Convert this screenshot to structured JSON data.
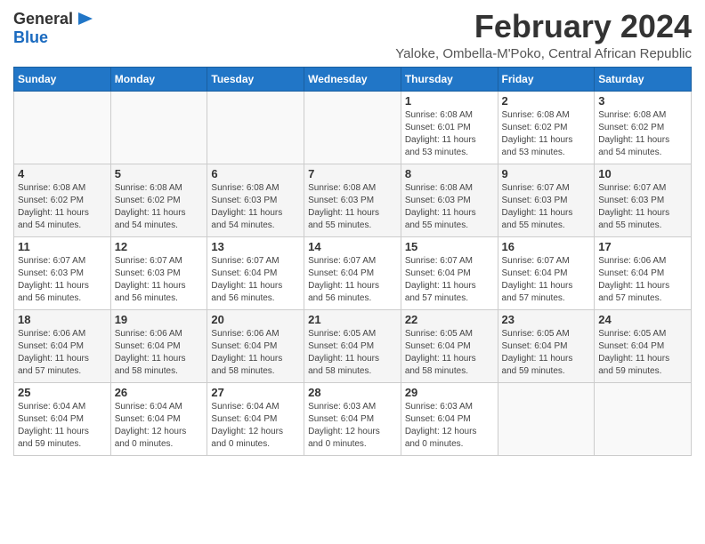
{
  "header": {
    "logo_general": "General",
    "logo_blue": "Blue",
    "month_year": "February 2024",
    "location": "Yaloke, Ombella-M'Poko, Central African Republic"
  },
  "weekdays": [
    "Sunday",
    "Monday",
    "Tuesday",
    "Wednesday",
    "Thursday",
    "Friday",
    "Saturday"
  ],
  "weeks": [
    [
      {
        "day": "",
        "info": ""
      },
      {
        "day": "",
        "info": ""
      },
      {
        "day": "",
        "info": ""
      },
      {
        "day": "",
        "info": ""
      },
      {
        "day": "1",
        "info": "Sunrise: 6:08 AM\nSunset: 6:01 PM\nDaylight: 11 hours\nand 53 minutes."
      },
      {
        "day": "2",
        "info": "Sunrise: 6:08 AM\nSunset: 6:02 PM\nDaylight: 11 hours\nand 53 minutes."
      },
      {
        "day": "3",
        "info": "Sunrise: 6:08 AM\nSunset: 6:02 PM\nDaylight: 11 hours\nand 54 minutes."
      }
    ],
    [
      {
        "day": "4",
        "info": "Sunrise: 6:08 AM\nSunset: 6:02 PM\nDaylight: 11 hours\nand 54 minutes."
      },
      {
        "day": "5",
        "info": "Sunrise: 6:08 AM\nSunset: 6:02 PM\nDaylight: 11 hours\nand 54 minutes."
      },
      {
        "day": "6",
        "info": "Sunrise: 6:08 AM\nSunset: 6:03 PM\nDaylight: 11 hours\nand 54 minutes."
      },
      {
        "day": "7",
        "info": "Sunrise: 6:08 AM\nSunset: 6:03 PM\nDaylight: 11 hours\nand 55 minutes."
      },
      {
        "day": "8",
        "info": "Sunrise: 6:08 AM\nSunset: 6:03 PM\nDaylight: 11 hours\nand 55 minutes."
      },
      {
        "day": "9",
        "info": "Sunrise: 6:07 AM\nSunset: 6:03 PM\nDaylight: 11 hours\nand 55 minutes."
      },
      {
        "day": "10",
        "info": "Sunrise: 6:07 AM\nSunset: 6:03 PM\nDaylight: 11 hours\nand 55 minutes."
      }
    ],
    [
      {
        "day": "11",
        "info": "Sunrise: 6:07 AM\nSunset: 6:03 PM\nDaylight: 11 hours\nand 56 minutes."
      },
      {
        "day": "12",
        "info": "Sunrise: 6:07 AM\nSunset: 6:03 PM\nDaylight: 11 hours\nand 56 minutes."
      },
      {
        "day": "13",
        "info": "Sunrise: 6:07 AM\nSunset: 6:04 PM\nDaylight: 11 hours\nand 56 minutes."
      },
      {
        "day": "14",
        "info": "Sunrise: 6:07 AM\nSunset: 6:04 PM\nDaylight: 11 hours\nand 56 minutes."
      },
      {
        "day": "15",
        "info": "Sunrise: 6:07 AM\nSunset: 6:04 PM\nDaylight: 11 hours\nand 57 minutes."
      },
      {
        "day": "16",
        "info": "Sunrise: 6:07 AM\nSunset: 6:04 PM\nDaylight: 11 hours\nand 57 minutes."
      },
      {
        "day": "17",
        "info": "Sunrise: 6:06 AM\nSunset: 6:04 PM\nDaylight: 11 hours\nand 57 minutes."
      }
    ],
    [
      {
        "day": "18",
        "info": "Sunrise: 6:06 AM\nSunset: 6:04 PM\nDaylight: 11 hours\nand 57 minutes."
      },
      {
        "day": "19",
        "info": "Sunrise: 6:06 AM\nSunset: 6:04 PM\nDaylight: 11 hours\nand 58 minutes."
      },
      {
        "day": "20",
        "info": "Sunrise: 6:06 AM\nSunset: 6:04 PM\nDaylight: 11 hours\nand 58 minutes."
      },
      {
        "day": "21",
        "info": "Sunrise: 6:05 AM\nSunset: 6:04 PM\nDaylight: 11 hours\nand 58 minutes."
      },
      {
        "day": "22",
        "info": "Sunrise: 6:05 AM\nSunset: 6:04 PM\nDaylight: 11 hours\nand 58 minutes."
      },
      {
        "day": "23",
        "info": "Sunrise: 6:05 AM\nSunset: 6:04 PM\nDaylight: 11 hours\nand 59 minutes."
      },
      {
        "day": "24",
        "info": "Sunrise: 6:05 AM\nSunset: 6:04 PM\nDaylight: 11 hours\nand 59 minutes."
      }
    ],
    [
      {
        "day": "25",
        "info": "Sunrise: 6:04 AM\nSunset: 6:04 PM\nDaylight: 11 hours\nand 59 minutes."
      },
      {
        "day": "26",
        "info": "Sunrise: 6:04 AM\nSunset: 6:04 PM\nDaylight: 12 hours\nand 0 minutes."
      },
      {
        "day": "27",
        "info": "Sunrise: 6:04 AM\nSunset: 6:04 PM\nDaylight: 12 hours\nand 0 minutes."
      },
      {
        "day": "28",
        "info": "Sunrise: 6:03 AM\nSunset: 6:04 PM\nDaylight: 12 hours\nand 0 minutes."
      },
      {
        "day": "29",
        "info": "Sunrise: 6:03 AM\nSunset: 6:04 PM\nDaylight: 12 hours\nand 0 minutes."
      },
      {
        "day": "",
        "info": ""
      },
      {
        "day": "",
        "info": ""
      }
    ]
  ]
}
